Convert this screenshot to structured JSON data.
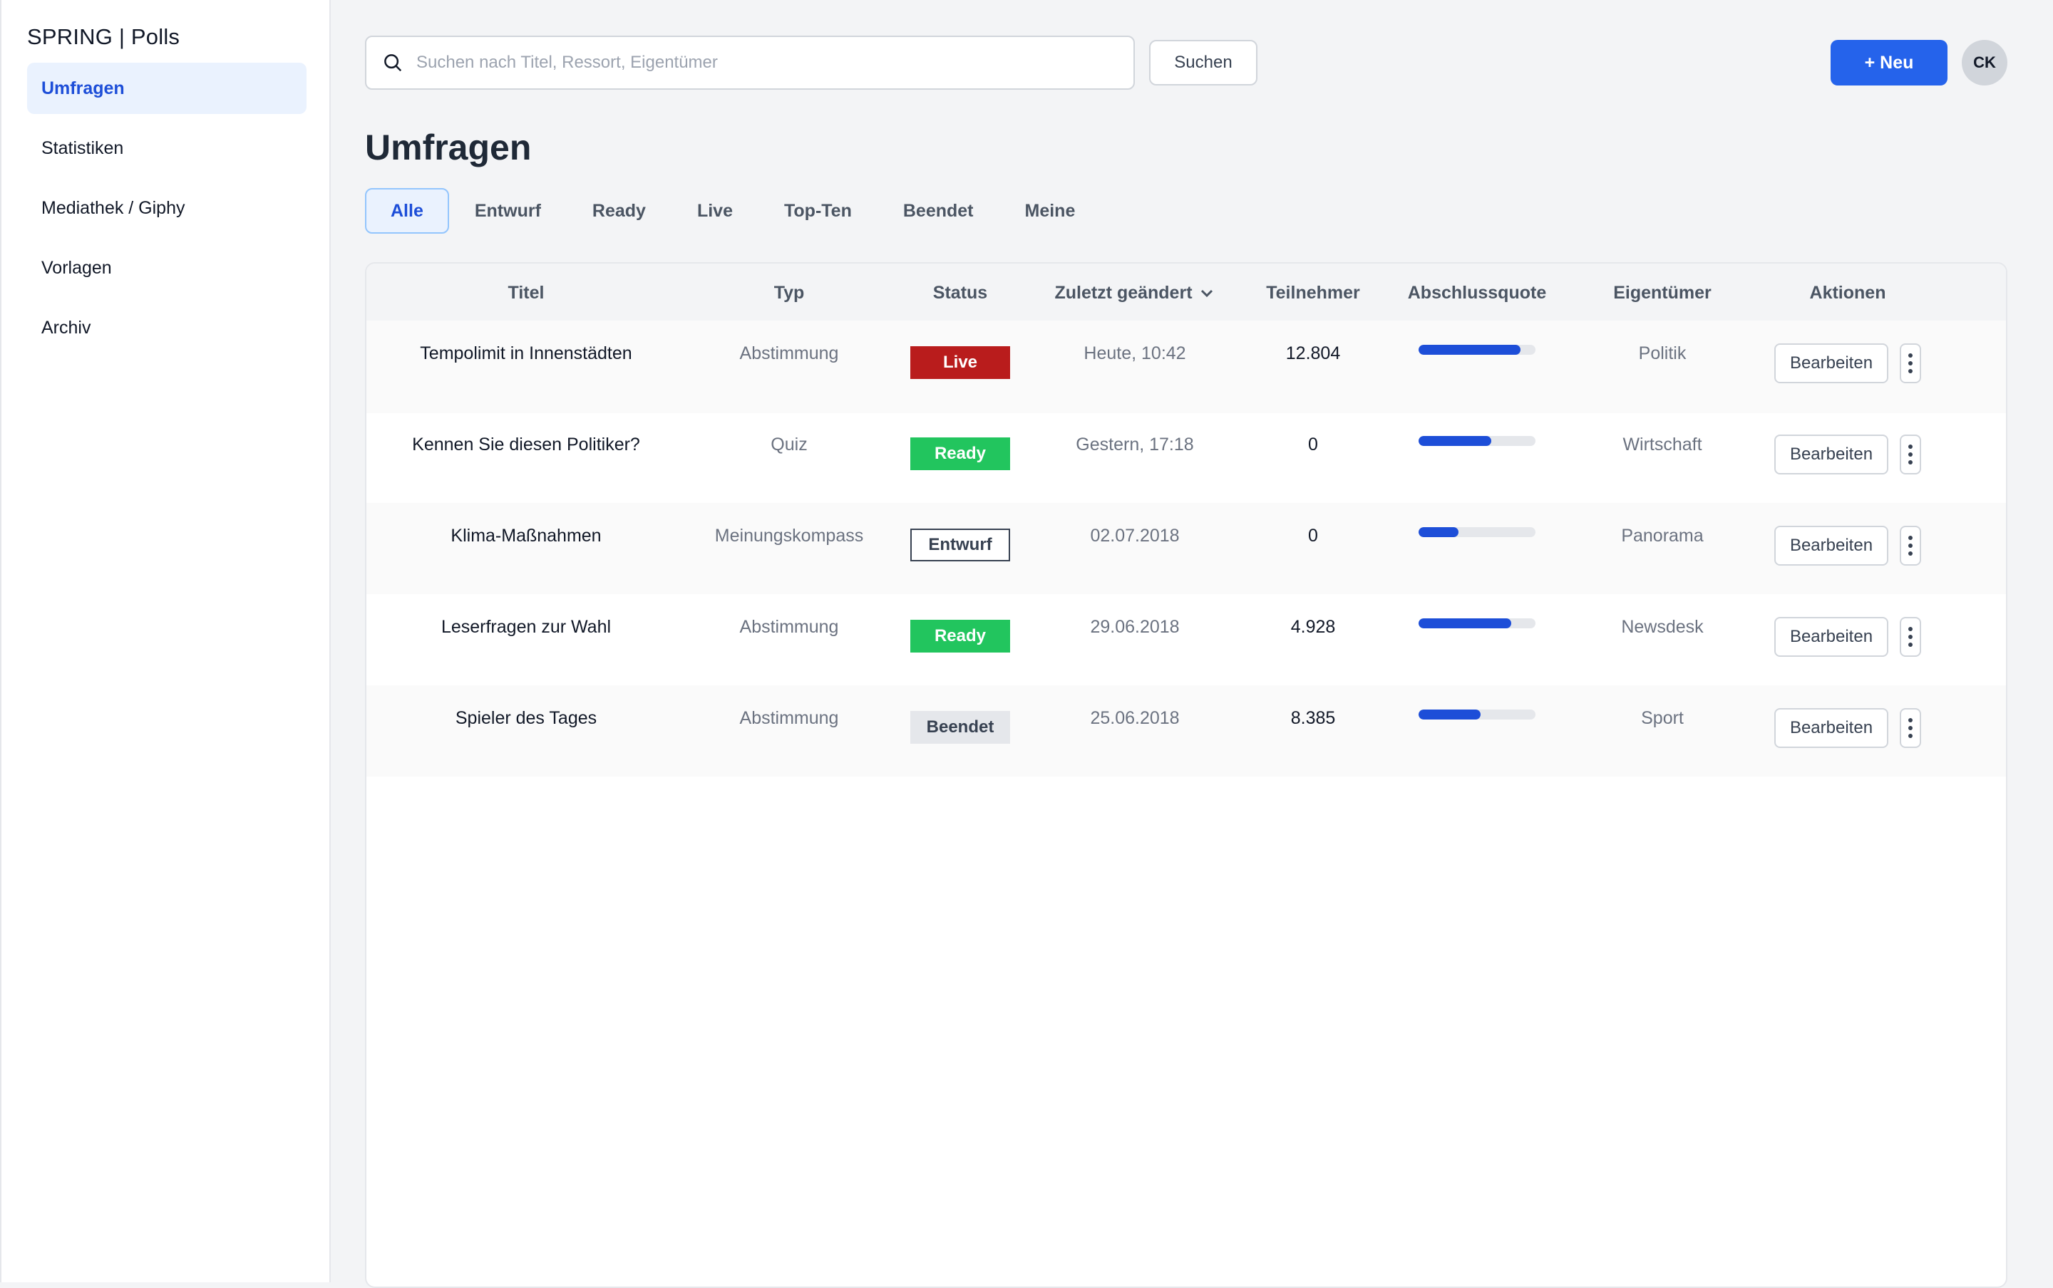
{
  "app": {
    "brand": "SPRING | Polls"
  },
  "sidebar": {
    "items": [
      {
        "label": "Umfragen",
        "active": true
      },
      {
        "label": "Statistiken"
      },
      {
        "label": "Mediathek / Giphy"
      },
      {
        "label": "Vorlagen"
      },
      {
        "label": "Archiv"
      }
    ]
  },
  "topbar": {
    "search_placeholder": "Suchen nach Titel, Ressort, Eigentümer",
    "search_value": "",
    "search_button": "Suchen",
    "new_button": "+ Neu",
    "avatar_initials": "CK",
    "icons": {
      "search": "search-icon"
    }
  },
  "page": {
    "title": "Umfragen"
  },
  "tabs": [
    {
      "label": "Alle",
      "active": true
    },
    {
      "label": "Entwurf"
    },
    {
      "label": "Ready"
    },
    {
      "label": "Live"
    },
    {
      "label": "Top-Ten"
    },
    {
      "label": "Beendet"
    },
    {
      "label": "Meine"
    }
  ],
  "table": {
    "columns": {
      "title": "Titel",
      "type": "Typ",
      "status": "Status",
      "changed": "Zuletzt geändert",
      "participants": "Teilnehmer",
      "completion": "Abschlussquote",
      "owner": "Eigentümer",
      "actions": "Aktionen"
    },
    "sort_icon": "chevron-down-icon",
    "rows": [
      {
        "title": "Tempolimit in Innenstädten",
        "type": "Abstimmung",
        "status": "Live",
        "status_kind": "live",
        "changed": "Heute, 10:42",
        "participants": "12.804",
        "completion": 0.87,
        "owner": "Politik",
        "edit": "Bearbeiten"
      },
      {
        "title": "Kennen Sie diesen Politiker?",
        "type": "Quiz",
        "status": "Ready",
        "status_kind": "ready",
        "changed": "Gestern, 17:18",
        "participants": "0",
        "completion": 0.62,
        "owner": "Wirtschaft",
        "edit": "Bearbeiten"
      },
      {
        "title": "Klima-Maßnahmen",
        "type": "Meinungskompass",
        "status": "Entwurf",
        "status_kind": "entwurf",
        "changed": "02.07.2018",
        "participants": "0",
        "completion": 0.34,
        "owner": "Panorama",
        "edit": "Bearbeiten"
      },
      {
        "title": "Leserfragen zur Wahl",
        "type": "Abstimmung",
        "status": "Ready",
        "status_kind": "ready",
        "changed": "29.06.2018",
        "participants": "4.928",
        "completion": 0.79,
        "owner": "Newsdesk",
        "edit": "Bearbeiten"
      },
      {
        "title": "Spieler des Tages",
        "type": "Abstimmung",
        "status": "Beendet",
        "status_kind": "beendet",
        "changed": "25.06.2018",
        "participants": "8.385",
        "completion": 0.53,
        "owner": "Sport",
        "edit": "Bearbeiten"
      }
    ]
  },
  "colors": {
    "accent": "#2563eb",
    "live": "#b91c1c",
    "ready": "#22c55e",
    "beendet": "#e5e7eb"
  }
}
